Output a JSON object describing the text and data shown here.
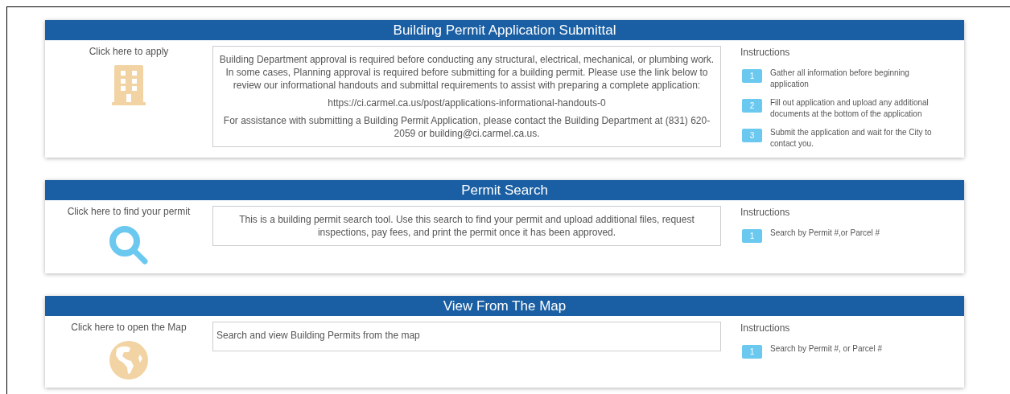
{
  "sections": [
    {
      "kind": "building",
      "title": "Building Permit Application Submittal",
      "link_label": "Click here to apply",
      "description": [
        "Building Department approval is required before conducting any structural, electrical, mechanical, or plumbing work. In some cases, Planning approval is required before submitting for a building permit. Please use the link below to review our informational handouts and submittal requirements to assist with preparing a complete application:",
        "https://ci.carmel.ca.us/post/applications-informational-handouts-0",
        "For assistance with submitting a Building Permit Application, please contact the Building Department at (831) 620-2059 or building@ci.carmel.ca.us."
      ],
      "centered": true,
      "instructions_title": "Instructions",
      "steps": [
        {
          "number": "1",
          "text": "Gather all information before beginning application"
        },
        {
          "number": "2",
          "text": "Fill out application and upload any additional documents at the bottom of the application"
        },
        {
          "number": "3",
          "text": "Submit the application and wait for the City to contact you."
        }
      ]
    },
    {
      "kind": "search",
      "title": "Permit Search",
      "link_label": "Click here to find your permit",
      "description": [
        "This is a building permit search tool. Use this search to find your permit and upload additional files, request inspections, pay fees, and print the permit once it has been approved."
      ],
      "centered": true,
      "instructions_title": "Instructions",
      "steps": [
        {
          "number": "1",
          "text": "Search by Permit #,or Parcel #"
        }
      ]
    },
    {
      "kind": "globe",
      "title": "View From The Map",
      "link_label": "Click here to open the Map",
      "description": [
        "Search and view Building Permits from the map"
      ],
      "centered": false,
      "instructions_title": "Instructions",
      "steps": [
        {
          "number": "1",
          "text": "Search by Permit #, or Parcel #"
        }
      ]
    }
  ]
}
